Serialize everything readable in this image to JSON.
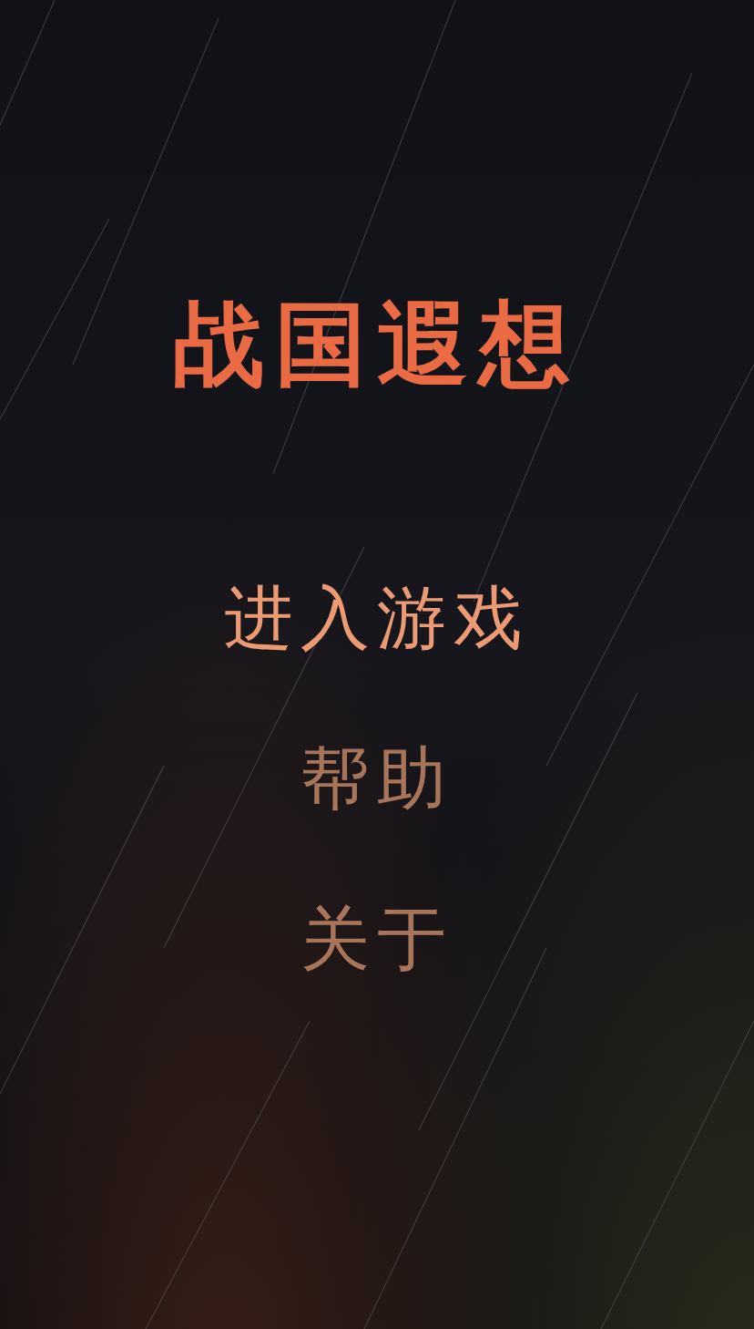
{
  "title": "战国遐想",
  "menu": [
    {
      "label": "进入游戏",
      "selected": true
    },
    {
      "label": "帮助",
      "selected": false
    },
    {
      "label": "关于",
      "selected": false
    }
  ]
}
